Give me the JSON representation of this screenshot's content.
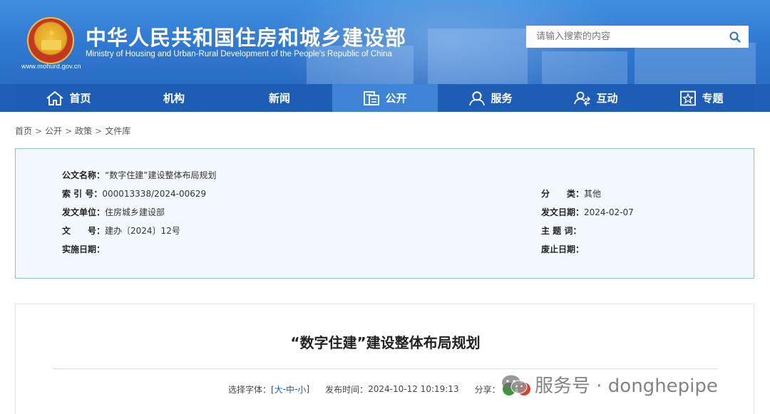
{
  "header": {
    "org_name_cn": "中华人民共和国住房和城乡建设部",
    "org_name_en": "Ministry of Housing and Urban-Rural Development of the People's Republic of China",
    "site_url": "www.mohurd.gov.cn",
    "search": {
      "placeholder": "请输入搜索的内容",
      "value": ""
    }
  },
  "nav": [
    {
      "label": "首页",
      "icon": "home-icon"
    },
    {
      "label": "机构",
      "icon": ""
    },
    {
      "label": "新闻",
      "icon": ""
    },
    {
      "label": "公开",
      "icon": "document-icon",
      "active": true
    },
    {
      "label": "服务",
      "icon": "user-service-icon"
    },
    {
      "label": "互动",
      "icon": "interaction-icon"
    },
    {
      "label": "专题",
      "icon": "star-icon"
    }
  ],
  "breadcrumb": [
    {
      "label": "首页"
    },
    {
      "label": "公开"
    },
    {
      "label": "政策"
    },
    {
      "label": "文件库"
    }
  ],
  "breadcrumb_sep": ">",
  "meta": {
    "doc_name_label": "公文名称：",
    "doc_name_value": "“数字住建”建设整体布局规划",
    "index_label": "索 引 号：",
    "index_value": "000013338/2024-00629",
    "category_label": "分　　类：",
    "category_value": "其他",
    "issuer_label": "发文单位：",
    "issuer_value": "住房城乡建设部",
    "issue_date_label": "发文日期：",
    "issue_date_value": "2024-02-07",
    "doc_no_label": "文　　号：",
    "doc_no_value": "建办〔2024〕12号",
    "keywords_label": "主 题 词：",
    "keywords_value": "",
    "effective_label": "实施日期：",
    "effective_value": "",
    "expiry_label": "废止日期：",
    "expiry_value": ""
  },
  "article": {
    "title": "“数字住建”建设整体布局规划",
    "font_select_label": "选择字体：[ ",
    "font_large": "大",
    "font_medium": "中",
    "font_small": "小",
    "font_dash": " - ",
    "font_close": " ]",
    "publish_label": "发布时间：",
    "publish_value": "2024-10-12 10:19:13",
    "share_label": "分享："
  },
  "watermark": {
    "text": "服务号 · donghepipe"
  },
  "colors": {
    "header_blue": "#2f78d1",
    "nav_blue": "#1e5db5",
    "nav_active": "#3f83d6",
    "meta_bg": "#f2f8fe",
    "meta_border": "#8fbce6",
    "link_blue": "#1a5fb4"
  }
}
